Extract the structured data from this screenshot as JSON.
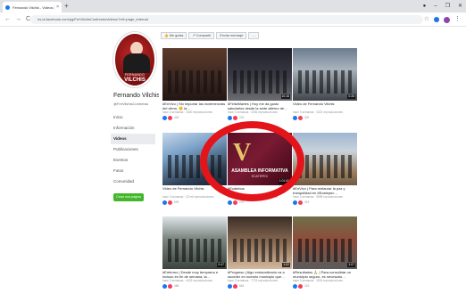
{
  "browser": {
    "tab_title": "Fernando Vilchis - Videos | Face",
    "close_glyph": "×",
    "new_tab_glyph": "+",
    "window_controls": [
      "●",
      "–",
      "❐",
      "✕"
    ],
    "nav": [
      "←",
      "→",
      "C"
    ],
    "url": "es-la.facebook.com/pg/FerVilchisContreras/videos/?ref=page_internal",
    "star_glyph": "☆",
    "menu_glyph": "⋮"
  },
  "page": {
    "avatar_top_text": "FERNANDO",
    "avatar_name": "VILCHIS",
    "name": "Fernando Vilchis",
    "handle": "@FerVilchisContreras"
  },
  "sidenav": [
    {
      "label": "Inicio"
    },
    {
      "label": "Información"
    },
    {
      "label": "Videos",
      "active": true
    },
    {
      "label": "Publicaciones"
    },
    {
      "label": "Eventos"
    },
    {
      "label": "Fotos"
    },
    {
      "label": "Comunidad"
    }
  ],
  "side_button": "Crear una página",
  "toolbar": [
    "👍 Me gusta",
    "↗ Compartir",
    "Enviar mensaje",
    "..."
  ],
  "videos": [
    {
      "title": "#EnVivo | Sin importar las inclemencias del clima, 🙂 la…",
      "meta": "hace 3 semanas · 3300 reproducciones",
      "count": "426",
      "duration": "",
      "style": "th-a"
    },
    {
      "title": "#FeliziMartes | Hoy me da gusto saludarlos desde la sede alterno de…",
      "meta": "hace 3 semanas · 2306 reproducciones",
      "count": "224",
      "duration": "10:16",
      "style": "th-b"
    },
    {
      "title": "Video de Fernando Vilchis",
      "meta": "hace 3 semanas · 4322 reproducciones",
      "count": "302",
      "duration": "0:28",
      "style": "th-c"
    },
    {
      "title": "Video de Fernando Vilchis",
      "meta": "hace 3 semanas · 22 mil reproducciones",
      "count": "593",
      "duration": "",
      "style": "th-d"
    },
    {
      "title": "#Ecatebus",
      "meta": "hace 3 semanas · 1500 reproducciones",
      "count": "270",
      "duration": "1:01:00",
      "style": "th-e",
      "logo": "V",
      "banner": "ASAMBLEA INFORMATIVA",
      "banner_sub": "ECATEPEC"
    },
    {
      "title": "#EnVivo | Para restaurar la paz y tranquilidad en #Ecatepec…",
      "meta": "hace 3 semanas · 5898 reproducciones",
      "count": "319",
      "duration": "",
      "style": "th-f"
    },
    {
      "title": "#Enfermo | Desde muy temprano e incluso en fin de semana, la…",
      "meta": "hace 3 semanas · 4023 reproducciones",
      "count": "488",
      "duration": "0:47",
      "style": "th-g"
    },
    {
      "title": "#Progreso | Algo extraordinario va a suceder en nuestro municipio que…",
      "meta": "hace 3 semanas · 7723 reproducciones",
      "count": "564",
      "duration": "1:02",
      "style": "th-h"
    },
    {
      "title": "#Resultados 🙏 | Para consolidar un municipio seguro, es necesario…",
      "meta": "hace 3 semanas · 3004 reproducciones",
      "count": "323",
      "duration": "1:07",
      "style": "th-i"
    }
  ],
  "colors": {
    "accent": "#1877f2",
    "highlight_ring": "#e3151b",
    "button_green": "#42b72a"
  }
}
